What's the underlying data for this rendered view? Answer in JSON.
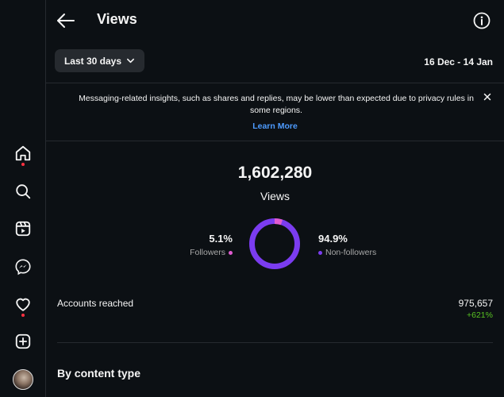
{
  "header": {
    "title": "Views"
  },
  "filters": {
    "range_label": "Last 30 days",
    "date_range": "16 Dec - 14 Jan"
  },
  "notice": {
    "text": "Messaging-related insights, such as shares and replies, may be lower than expected due to privacy rules in some regions.",
    "link": "Learn More"
  },
  "summary": {
    "total": "1,602,280",
    "total_label": "Views"
  },
  "breakdown": {
    "followers_pct": "5.1%",
    "followers_label": "Followers",
    "followers_color": "#e05bd0",
    "followers_fraction": 0.051,
    "nonfollowers_pct": "94.9%",
    "nonfollowers_label": "Non-followers",
    "nonfollowers_color": "#7b3cf0",
    "nonfollowers_fraction": 0.949
  },
  "accounts": {
    "label": "Accounts reached",
    "value": "975,657",
    "change": "+621%",
    "change_color": "#58c322"
  },
  "section": {
    "title": "By content type"
  },
  "sidebar": {
    "items": [
      {
        "icon": "home-icon",
        "active": true
      },
      {
        "icon": "search-icon"
      },
      {
        "icon": "reels-icon"
      },
      {
        "icon": "messenger-icon"
      },
      {
        "icon": "heart-icon",
        "badge": true
      },
      {
        "icon": "create-icon"
      },
      {
        "icon": "profile-avatar"
      }
    ]
  }
}
